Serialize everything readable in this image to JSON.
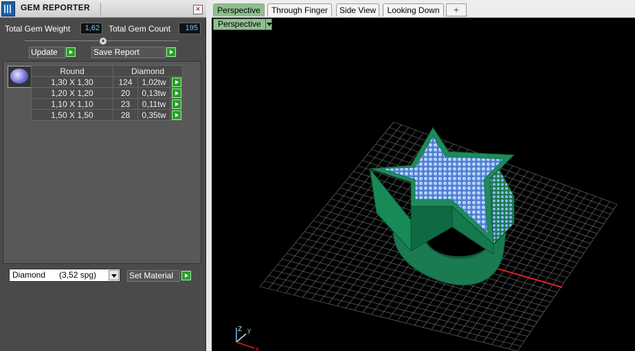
{
  "panel": {
    "title": "GEM REPORTER",
    "close": "×",
    "total_weight_label": "Total Gem Weight",
    "total_weight_value": "1,62",
    "total_count_label": "Total Gem Count",
    "total_count_value": "195",
    "update_label": "Update",
    "save_report_label": "Save Report",
    "table": {
      "headers": [
        "Round",
        "Diamond"
      ],
      "rows": [
        {
          "size": "1,30 X 1,30",
          "count": "124",
          "weight": "1,02tw"
        },
        {
          "size": "1,20 X 1,20",
          "count": "20",
          "weight": "0,13tw"
        },
        {
          "size": "1,10 X 1,10",
          "count": "23",
          "weight": "0,11tw"
        },
        {
          "size": "1,50 X 1,50",
          "count": "28",
          "weight": "0,35tw"
        }
      ]
    },
    "material_value": "Diamond      (3,52 spg)",
    "set_material_label": "Set Material"
  },
  "tabs": [
    "Perspective",
    "Through Finger",
    "Side View",
    "Looking Down"
  ],
  "tab_add": "+",
  "viewport": {
    "mode": "Perspective",
    "axes": {
      "z": "Z",
      "y": "y",
      "x": "x"
    }
  },
  "colors": {
    "ring_green": "#1f8a5c",
    "gem_blue": "#8fb8ff",
    "grid": "#7a7a7a",
    "accent_green": "#2f9a2f",
    "tab_active": "#8fbf8f"
  }
}
